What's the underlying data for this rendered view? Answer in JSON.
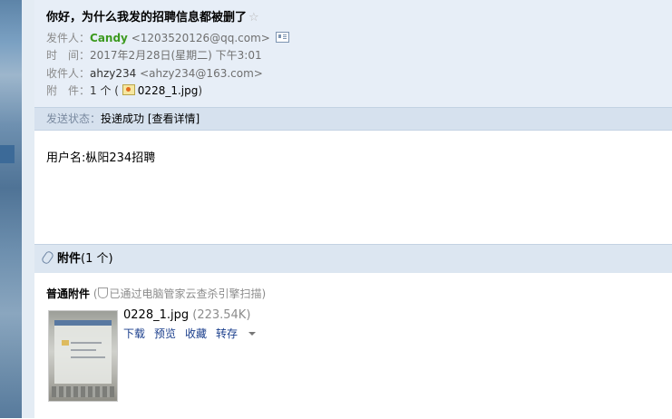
{
  "subject": "你好，为什么我发的招聘信息都被删了",
  "star_glyph": "☆",
  "sender": {
    "label": "发件人：",
    "name": "Candy",
    "email": "<1203520126@qq.com>"
  },
  "time": {
    "label": "时　间：",
    "value": "2017年2月28日(星期二) 下午3:01"
  },
  "recipient": {
    "label": "收件人：",
    "name": "ahzy234",
    "email": "<ahzy234@163.com>"
  },
  "attachment_meta": {
    "label": "附　件：",
    "count_prefix": "1 个 (",
    "file": "0228_1.jpg",
    "count_suffix": ")"
  },
  "send_status": {
    "label": "发送状态：",
    "value": "投递成功",
    "details_link": "[查看详情]"
  },
  "body": "用户名:枞阳234招聘",
  "attachments": {
    "header_bold": "附件",
    "header_count": "(1 个)",
    "section_title": "普通附件",
    "scan_note_open": "(",
    "scan_note": "已通过电脑管家云查杀引擎扫描",
    "scan_note_close": ")",
    "file_name": "0228_1.jpg",
    "file_size": "(223.54K)",
    "actions": [
      "下载",
      "预览",
      "收藏",
      "转存"
    ]
  },
  "colors": {
    "header_bg": "#e7eef7",
    "sender_name": "#3d9a1f",
    "link": "#1a3e8c"
  },
  "icons": [
    "star-icon",
    "contact-card-icon",
    "image-file-icon",
    "paperclip-icon",
    "shield-icon",
    "dropdown-caret-icon"
  ]
}
